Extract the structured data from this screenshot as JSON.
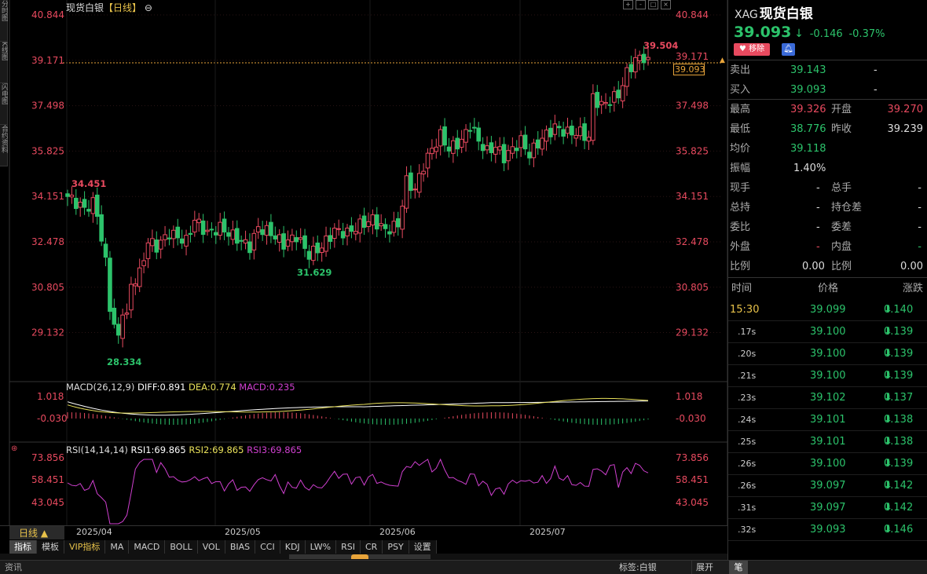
{
  "chart": {
    "title": "现货白银",
    "period": "【日线】",
    "price_axis_ticks": [
      "40.844",
      "39.171",
      "37.498",
      "35.825",
      "34.151",
      "32.478",
      "30.805",
      "29.132"
    ],
    "current_price_tag": "39.093",
    "marks": {
      "high": "39.504",
      "start_high": "34.451",
      "low": "28.334",
      "local_low": "31.629"
    },
    "macd": {
      "label": "MACD(26,12,9)",
      "diff": "DIFF:0.891",
      "dea": "DEA:0.774",
      "macd": "MACD:0.235",
      "ticks": [
        "1.018",
        "-0.030"
      ]
    },
    "rsi": {
      "label": "RSI(14,14,14)",
      "rsi1": "RSI1:69.865",
      "rsi2": "RSI2:69.865",
      "rsi3": "RSI3:69.865",
      "ticks": [
        "73.856",
        "58.451",
        "43.045"
      ]
    },
    "x_labels": [
      "2025/04",
      "2025/05",
      "2025/06",
      "2025/07"
    ],
    "timeframe": "日线 ▲",
    "indicator_tabs": [
      "指标",
      "模板",
      "VIP指标",
      "MA",
      "MACD",
      "BOLL",
      "VOL",
      "BIAS",
      "CCI",
      "KDJ",
      "LW%",
      "RSI",
      "CR",
      "PSY",
      "设置"
    ]
  },
  "left_tabs": [
    "分时图",
    "K线图",
    "闪电图",
    "合约资料"
  ],
  "quote": {
    "code": "XAG",
    "name": "现货白银",
    "price": "39.093",
    "arrow": "↓",
    "change": "-0.146",
    "change_pct": "-0.37%",
    "remove_label": "移除"
  },
  "order_book": [
    {
      "label": "卖出",
      "value": "39.143",
      "vol": "-"
    },
    {
      "label": "买入",
      "value": "39.093",
      "vol": "-"
    }
  ],
  "stats": [
    {
      "l1": "最高",
      "v1": "39.326",
      "l2": "开盘",
      "v2": "39.270"
    },
    {
      "l1": "最低",
      "v1": "38.776",
      "l2": "昨收",
      "v2": "39.239"
    },
    {
      "l1": "均价",
      "v1": "39.118",
      "l2": "",
      "v2": ""
    },
    {
      "l1": "振幅",
      "v1": "1.40%",
      "l2": "",
      "v2": ""
    },
    {
      "l1": "现手",
      "v1": "-",
      "l2": "总手",
      "v2": "-"
    },
    {
      "l1": "总持",
      "v1": "-",
      "l2": "持仓差",
      "v2": "-"
    },
    {
      "l1": "委比",
      "v1": "-",
      "l2": "委差",
      "v2": "-"
    },
    {
      "l1": "外盘",
      "v1": "-",
      "l2": "内盘",
      "v2": "-"
    },
    {
      "l1": "比例",
      "v1": "0.00",
      "l2": "比例",
      "v2": "0.00"
    }
  ],
  "ticks_header": {
    "time": "时间",
    "price": "价格",
    "change": "涨跌"
  },
  "ticks": [
    {
      "time": "15:30",
      "price": "39.099",
      "change": "0.140"
    },
    {
      "time": ".17s",
      "price": "39.100",
      "change": "0.139"
    },
    {
      "time": ".20s",
      "price": "39.100",
      "change": "0.139"
    },
    {
      "time": ".21s",
      "price": "39.100",
      "change": "0.139"
    },
    {
      "time": ".23s",
      "price": "39.102",
      "change": "0.137"
    },
    {
      "time": ".24s",
      "price": "39.101",
      "change": "0.138"
    },
    {
      "time": ".25s",
      "price": "39.101",
      "change": "0.138"
    },
    {
      "time": ".26s",
      "price": "39.100",
      "change": "0.139"
    },
    {
      "time": ".26s",
      "price": "39.097",
      "change": "0.142"
    },
    {
      "time": ".31s",
      "price": "39.097",
      "change": "0.142"
    },
    {
      "time": ".32s",
      "price": "39.093",
      "change": "0.146"
    }
  ],
  "status": {
    "info": "资讯",
    "tag": "标签:白银",
    "expand": "展开",
    "pen": "笔"
  },
  "colors": {
    "up": "#e84a5f",
    "down": "#2cc36b",
    "accent": "#e8c24a",
    "diff": "#ffffff",
    "dea": "#e8e05a",
    "macd": "#d040d0"
  }
}
